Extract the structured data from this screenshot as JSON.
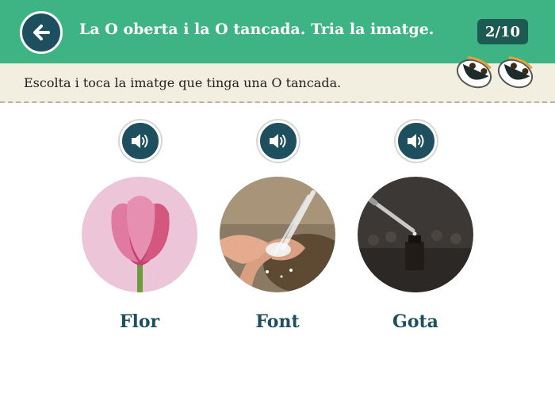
{
  "header": {
    "title": "La O oberta i la O tancada. Tria la imatge.",
    "counter": "2/10",
    "back_icon": "arrow-left-icon"
  },
  "instruction": "Escolta i toca la imatge que tinga una O tancada.",
  "options": [
    {
      "word": "Flor",
      "image": "pink tulip",
      "audio_icon": "speaker-icon"
    },
    {
      "word": "Font",
      "image": "hands under flowing water",
      "audio_icon": "speaker-icon"
    },
    {
      "word": "Gota",
      "image": "dropper over small bottle",
      "audio_icon": "speaker-icon"
    }
  ],
  "colors": {
    "header": "#3eb383",
    "button": "#1d4f5e",
    "counter": "#1d5a52",
    "instruction_bar": "#f3efe0",
    "word": "#1d4f5e"
  }
}
